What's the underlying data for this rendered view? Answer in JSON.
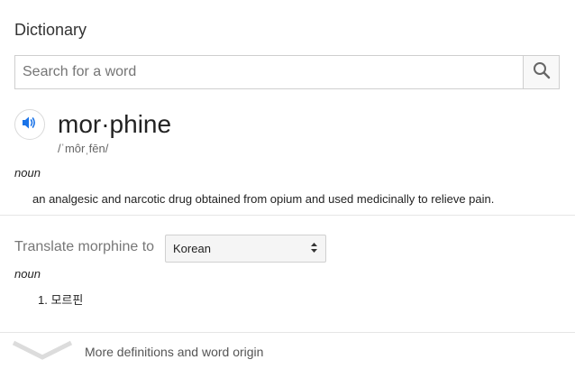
{
  "header": {
    "title": "Dictionary"
  },
  "search": {
    "placeholder": "Search for a word",
    "value": "",
    "icon": "search-icon"
  },
  "entry": {
    "speaker_icon": "speaker-icon",
    "word": "mor·phine",
    "phonetic": "/ˈmôrˌfēn/",
    "part_of_speech": "noun",
    "definition": "an analgesic and narcotic drug obtained from opium and used medicinally to relieve pain."
  },
  "translate": {
    "label": "Translate morphine to",
    "selected_language": "Korean",
    "part_of_speech": "noun",
    "results": [
      {
        "index": "1.",
        "text": "모르핀"
      }
    ]
  },
  "footer": {
    "more_label": "More definitions and word origin",
    "icon": "chevron-down-icon"
  },
  "colors": {
    "accent_blue": "#1a73e8",
    "text": "#222222",
    "muted": "#777777",
    "divider": "#e6e6e6"
  }
}
